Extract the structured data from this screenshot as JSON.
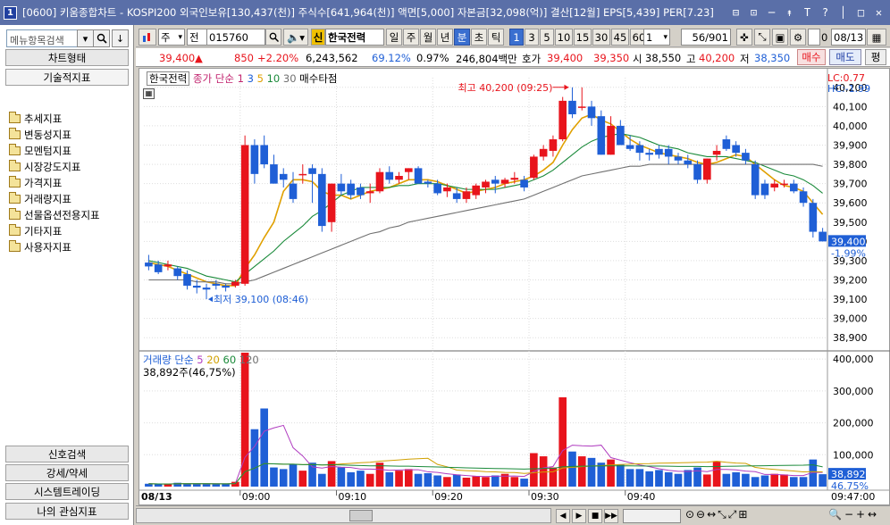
{
  "window": {
    "app_badge": "1",
    "title": "[0600] 키움종합차트 - KOSPI200 외국인보유[130,437(천)] 주식수[641,964(천)] 액면[5,000] 자본금[32,098(억)] 결산[12월] EPS[5,439] PER[7.23]",
    "buttons": [
      "⊟",
      "⊡",
      "─",
      "↟",
      "T",
      "?",
      "│",
      "□",
      "✕"
    ]
  },
  "left_panel": {
    "search_placeholder": "메뉴항목검색",
    "search_buttons": [
      "▾",
      "🔍",
      "↓"
    ],
    "top_tabs": [
      "차트형태",
      "기술적지표"
    ],
    "tree": [
      "추세지표",
      "변동성지표",
      "모멘텀지표",
      "시장강도지표",
      "가격지표",
      "거래량지표",
      "선물옵션전용지표",
      "기타지표",
      "사용자지표"
    ],
    "bottom_tabs": [
      "신호검색",
      "강세/약세",
      "시스템트레이딩",
      "나의 관심지표"
    ]
  },
  "toolbar": {
    "market": "주",
    "type": "전",
    "code": "015760",
    "sin_badge": "신",
    "stock_name": "한국전력",
    "periods": [
      "일",
      "주",
      "월",
      "년",
      "분",
      "초",
      "틱"
    ],
    "active_period": "분",
    "intervals": [
      "1",
      "3",
      "5",
      "10",
      "15",
      "30",
      "45",
      "60"
    ],
    "active_interval": "1",
    "unit": "1",
    "count": "56",
    "count_total": "/901",
    "zero_label": "0",
    "date": "08/13"
  },
  "info": {
    "price": "39,400",
    "arrow": "▲",
    "change": "850",
    "change_pct": "+2.20%",
    "volume": "6,243,562",
    "vol_ratio": "69.12%",
    "turnover": "0.97%",
    "amount": "246,804백만",
    "hoga_label": "호가",
    "ask": "39,400",
    "bid": "39,350",
    "open_label": "시",
    "open": "38,550",
    "high_label": "고",
    "high": "40,200",
    "low_label": "저",
    "low": "38,350",
    "buy": "매수",
    "sell": "매도",
    "eval": "평"
  },
  "price_legend": {
    "name": "한국전력",
    "ma_prefix": "종가 단순",
    "ma": [
      "1",
      "3",
      "5",
      "10",
      "30"
    ],
    "extra": "매수타점",
    "lc": "LC:0.77",
    "hc": "HC:-1.99",
    "high_note": "최고 40,200 (09:25)",
    "low_note": "최저 39,100 (08:46)",
    "current": "39,400",
    "current_pct": "-1.99%"
  },
  "volume_legend": {
    "title": "거래량 단순",
    "ma": [
      "5",
      "20",
      "60",
      "120"
    ],
    "current": "38,892주(46,75%)",
    "badge": "38,892",
    "pct": "46.75%"
  },
  "axes": {
    "date": "08/13",
    "times": [
      "09:00",
      "09:10",
      "09:20",
      "09:30",
      "09:40"
    ],
    "end_time": "09:47:00",
    "price_ticks": [
      "40,200",
      "40,100",
      "40,000",
      "39,900",
      "39,800",
      "39,700",
      "39,600",
      "39,500",
      "39,400",
      "39,300",
      "39,200",
      "39,100",
      "39,000",
      "38,900"
    ],
    "volume_ticks": [
      "400,000",
      "300,000",
      "200,000",
      "100,000"
    ]
  },
  "colors": {
    "up": "#e8141c",
    "down": "#1f5fd6",
    "ma1": "#e0a000",
    "ma2": "#1a8a3a",
    "ma3": "#707070",
    "vol_ma1": "#b03cc0",
    "vol_ma2": "#d0a000"
  },
  "chart_data": {
    "type": "candlestick",
    "price_range": [
      38850,
      40250
    ],
    "volume_range": [
      0,
      420000
    ],
    "candles": [
      {
        "o": 39290,
        "h": 39330,
        "l": 39250,
        "c": 39270
      },
      {
        "o": 39280,
        "h": 39300,
        "l": 39230,
        "c": 39240
      },
      {
        "o": 39270,
        "h": 39300,
        "l": 39250,
        "c": 39280
      },
      {
        "o": 39260,
        "h": 39270,
        "l": 39200,
        "c": 39220
      },
      {
        "o": 39230,
        "h": 39250,
        "l": 39150,
        "c": 39170
      },
      {
        "o": 39170,
        "h": 39200,
        "l": 39130,
        "c": 39160
      },
      {
        "o": 39160,
        "h": 39180,
        "l": 39100,
        "c": 39150
      },
      {
        "o": 39180,
        "h": 39200,
        "l": 39150,
        "c": 39170
      },
      {
        "o": 39170,
        "h": 39180,
        "l": 39140,
        "c": 39160
      },
      {
        "o": 39170,
        "h": 39200,
        "l": 39160,
        "c": 39190
      },
      {
        "o": 39180,
        "h": 39950,
        "l": 39170,
        "c": 39900
      },
      {
        "o": 39900,
        "h": 39930,
        "l": 39700,
        "c": 39750
      },
      {
        "o": 39900,
        "h": 39950,
        "l": 39780,
        "c": 39800
      },
      {
        "o": 39800,
        "h": 39850,
        "l": 39700,
        "c": 39700
      },
      {
        "o": 39750,
        "h": 39780,
        "l": 39680,
        "c": 39720
      },
      {
        "o": 39700,
        "h": 39760,
        "l": 39600,
        "c": 39620
      },
      {
        "o": 39750,
        "h": 39800,
        "l": 39700,
        "c": 39750
      },
      {
        "o": 39780,
        "h": 39800,
        "l": 39600,
        "c": 39750
      },
      {
        "o": 39750,
        "h": 39780,
        "l": 39450,
        "c": 39480
      },
      {
        "o": 39500,
        "h": 39700,
        "l": 39450,
        "c": 39700
      },
      {
        "o": 39700,
        "h": 39750,
        "l": 39640,
        "c": 39660
      },
      {
        "o": 39700,
        "h": 39720,
        "l": 39620,
        "c": 39640
      },
      {
        "o": 39680,
        "h": 39700,
        "l": 39620,
        "c": 39640
      },
      {
        "o": 39650,
        "h": 39700,
        "l": 39600,
        "c": 39660
      },
      {
        "o": 39660,
        "h": 39780,
        "l": 39650,
        "c": 39760
      },
      {
        "o": 39760,
        "h": 39790,
        "l": 39700,
        "c": 39720
      },
      {
        "o": 39720,
        "h": 39760,
        "l": 39700,
        "c": 39740
      },
      {
        "o": 39760,
        "h": 39780,
        "l": 39720,
        "c": 39780
      },
      {
        "o": 39780,
        "h": 39790,
        "l": 39700,
        "c": 39700
      },
      {
        "o": 39710,
        "h": 39720,
        "l": 39680,
        "c": 39700
      },
      {
        "o": 39700,
        "h": 39720,
        "l": 39640,
        "c": 39650
      },
      {
        "o": 39660,
        "h": 39700,
        "l": 39630,
        "c": 39680
      },
      {
        "o": 39650,
        "h": 39680,
        "l": 39600,
        "c": 39620
      },
      {
        "o": 39620,
        "h": 39680,
        "l": 39600,
        "c": 39660
      },
      {
        "o": 39640,
        "h": 39700,
        "l": 39620,
        "c": 39690
      },
      {
        "o": 39680,
        "h": 39720,
        "l": 39650,
        "c": 39710
      },
      {
        "o": 39720,
        "h": 39740,
        "l": 39650,
        "c": 39700
      },
      {
        "o": 39700,
        "h": 39730,
        "l": 39680,
        "c": 39720
      },
      {
        "o": 39720,
        "h": 39760,
        "l": 39700,
        "c": 39730
      },
      {
        "o": 39720,
        "h": 39740,
        "l": 39660,
        "c": 39680
      },
      {
        "o": 39730,
        "h": 39850,
        "l": 39720,
        "c": 39840
      },
      {
        "o": 39840,
        "h": 39900,
        "l": 39820,
        "c": 39880
      },
      {
        "o": 39870,
        "h": 39950,
        "l": 39840,
        "c": 39930
      },
      {
        "o": 39930,
        "h": 40150,
        "l": 39920,
        "c": 40130
      },
      {
        "o": 40130,
        "h": 40200,
        "l": 40040,
        "c": 40060
      },
      {
        "o": 40100,
        "h": 40200,
        "l": 40080,
        "c": 40100
      },
      {
        "o": 40100,
        "h": 40130,
        "l": 40000,
        "c": 40040
      },
      {
        "o": 40050,
        "h": 40080,
        "l": 39850,
        "c": 39850
      },
      {
        "o": 39850,
        "h": 40050,
        "l": 39850,
        "c": 40000
      },
      {
        "o": 40000,
        "h": 40030,
        "l": 39900,
        "c": 39900
      },
      {
        "o": 39900,
        "h": 39950,
        "l": 39870,
        "c": 39880
      },
      {
        "o": 39900,
        "h": 39920,
        "l": 39820,
        "c": 39860
      },
      {
        "o": 39860,
        "h": 39880,
        "l": 39820,
        "c": 39850
      },
      {
        "o": 39880,
        "h": 39900,
        "l": 39830,
        "c": 39850
      },
      {
        "o": 39880,
        "h": 39900,
        "l": 39800,
        "c": 39840
      },
      {
        "o": 39840,
        "h": 39860,
        "l": 39800,
        "c": 39820
      },
      {
        "o": 39820,
        "h": 39850,
        "l": 39780,
        "c": 39800
      },
      {
        "o": 39800,
        "h": 39820,
        "l": 39700,
        "c": 39720
      },
      {
        "o": 39720,
        "h": 39830,
        "l": 39700,
        "c": 39830
      },
      {
        "o": 39850,
        "h": 39900,
        "l": 39820,
        "c": 39870
      },
      {
        "o": 39930,
        "h": 39950,
        "l": 39870,
        "c": 39880
      },
      {
        "o": 39900,
        "h": 39920,
        "l": 39840,
        "c": 39860
      },
      {
        "o": 39860,
        "h": 39880,
        "l": 39800,
        "c": 39820
      },
      {
        "o": 39800,
        "h": 39820,
        "l": 39620,
        "c": 39640
      },
      {
        "o": 39700,
        "h": 39720,
        "l": 39620,
        "c": 39640
      },
      {
        "o": 39680,
        "h": 39720,
        "l": 39660,
        "c": 39700
      },
      {
        "o": 39700,
        "h": 39720,
        "l": 39680,
        "c": 39700
      },
      {
        "o": 39700,
        "h": 39720,
        "l": 39650,
        "c": 39660
      },
      {
        "o": 39660,
        "h": 39680,
        "l": 39580,
        "c": 39600
      },
      {
        "o": 39600,
        "h": 39620,
        "l": 39420,
        "c": 39450
      },
      {
        "o": 39450,
        "h": 39470,
        "l": 39400,
        "c": 39400
      }
    ],
    "volume": [
      9000,
      8000,
      7000,
      12000,
      9000,
      10000,
      8000,
      7000,
      9000,
      15000,
      420000,
      180000,
      245000,
      60000,
      55000,
      70000,
      50000,
      75000,
      40000,
      80000,
      60000,
      45000,
      50000,
      40000,
      75000,
      45000,
      50000,
      55000,
      40000,
      42000,
      35000,
      30000,
      38000,
      28000,
      32000,
      30000,
      35000,
      40000,
      30000,
      25000,
      105000,
      95000,
      60000,
      280000,
      110000,
      95000,
      90000,
      75000,
      85000,
      70000,
      55000,
      55000,
      48000,
      52000,
      45000,
      40000,
      52000,
      60000,
      38000,
      80000,
      40000,
      45000,
      40000,
      30000,
      35000,
      40000,
      38000,
      30000,
      30000,
      85000,
      38892
    ],
    "ma_series": [
      {
        "name": "MA5",
        "values": [
          39290,
          39280,
          39270,
          39250,
          39230,
          39210,
          39190,
          39180,
          39170,
          39170,
          39260,
          39330,
          39420,
          39500,
          39660,
          39720,
          39720,
          39710,
          39660,
          39640,
          39640,
          39620,
          39640,
          39660,
          39670,
          39680,
          39700,
          39720,
          39720,
          39720,
          39710,
          39690,
          39670,
          39650,
          39660,
          39670,
          39680,
          39700,
          39710,
          39720,
          39740,
          39770,
          39810,
          39900,
          39980,
          40040,
          40060,
          40030,
          40010,
          39970,
          39930,
          39900,
          39880,
          39860,
          39850,
          39840,
          39830,
          39810,
          39800,
          39810,
          39830,
          39850,
          39840,
          39800,
          39760,
          39720,
          39690,
          39680,
          39660,
          39600,
          39540
        ]
      },
      {
        "name": "MA10",
        "values": [
          39300,
          39290,
          39280,
          39270,
          39260,
          39240,
          39220,
          39210,
          39200,
          39190,
          39230,
          39270,
          39310,
          39350,
          39400,
          39440,
          39480,
          39530,
          39560,
          39600,
          39640,
          39660,
          39680,
          39680,
          39680,
          39680,
          39690,
          39690,
          39700,
          39700,
          39700,
          39690,
          39680,
          39670,
          39670,
          39670,
          39670,
          39680,
          39690,
          39700,
          39720,
          39740,
          39770,
          39810,
          39850,
          39890,
          39920,
          39940,
          39950,
          39960,
          39950,
          39940,
          39920,
          39900,
          39890,
          39880,
          39860,
          39850,
          39840,
          39840,
          39840,
          39830,
          39820,
          39810,
          39790,
          39770,
          39750,
          39740,
          39720,
          39690,
          39650
        ]
      },
      {
        "name": "MA30",
        "values": [
          39200,
          39200,
          39200,
          39200,
          39200,
          39190,
          39190,
          39190,
          39180,
          39180,
          39190,
          39200,
          39220,
          39240,
          39260,
          39280,
          39300,
          39320,
          39340,
          39360,
          39380,
          39400,
          39420,
          39440,
          39450,
          39470,
          39480,
          39500,
          39510,
          39520,
          39530,
          39540,
          39550,
          39560,
          39570,
          39580,
          39590,
          39600,
          39610,
          39620,
          39640,
          39660,
          39680,
          39700,
          39720,
          39740,
          39750,
          39760,
          39770,
          39780,
          39790,
          39790,
          39800,
          39800,
          39800,
          39800,
          39800,
          39800,
          39800,
          39800,
          39800,
          39800,
          39800,
          39800,
          39800,
          39800,
          39800,
          39800,
          39800,
          39800,
          39790
        ]
      }
    ]
  }
}
